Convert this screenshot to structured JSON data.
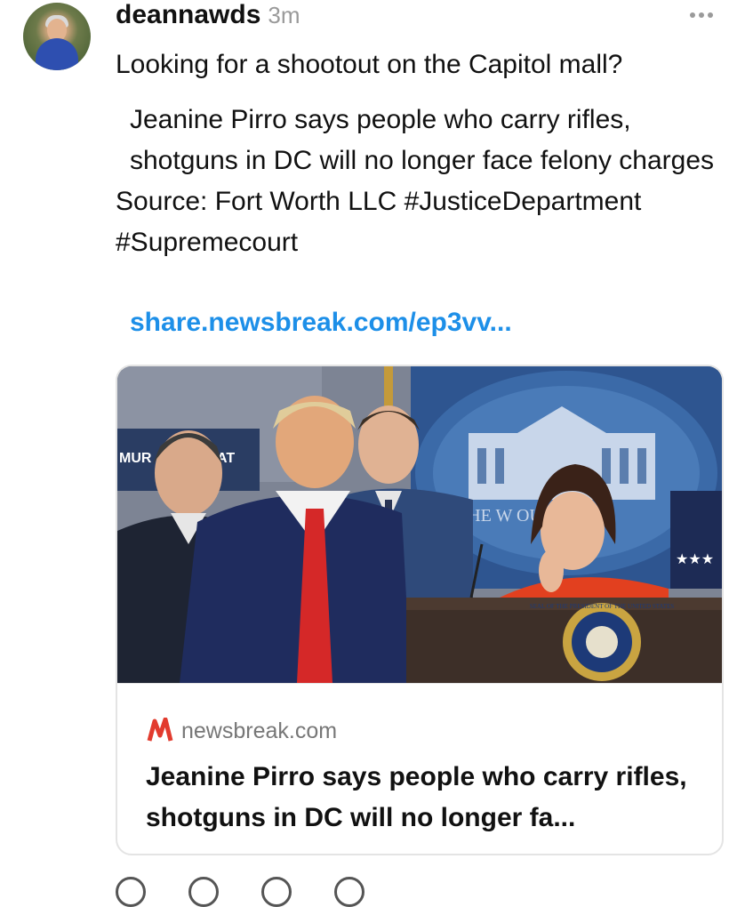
{
  "post": {
    "username": "deannawds",
    "timestamp": "3m",
    "text_line1": "Looking for a shootout on the Capitol mall?",
    "text_line2": "Jeanine Pirro says people who carry rifles, shotguns in DC will no longer face felony charges",
    "text_line3": "Source: Fort Worth LLC #JusticeDepartment #Supremecourt",
    "link_text": "share.newsbreak.com/ep3vv..."
  },
  "link_card": {
    "image_alt": "Press briefing room at a podium",
    "sign_left": "MUR",
    "sign_mid": "AT",
    "backdrop_text": "THE W  OUSE",
    "seal_text": "SEAL OF THE PRESIDENT OF THE UNITED STATES",
    "source_domain": "newsbreak.com",
    "title": "Jeanine Pirro says people who carry rifles, shotguns in DC will no longer fa..."
  },
  "icons": {
    "more": "more-horizontal-icon",
    "source": "newsbreak-logo-icon",
    "actions": [
      "like-icon",
      "reply-icon",
      "repost-icon",
      "share-icon"
    ]
  },
  "colors": {
    "link": "#1d8fe8",
    "muted": "#9a9a9a",
    "text": "#111111"
  }
}
